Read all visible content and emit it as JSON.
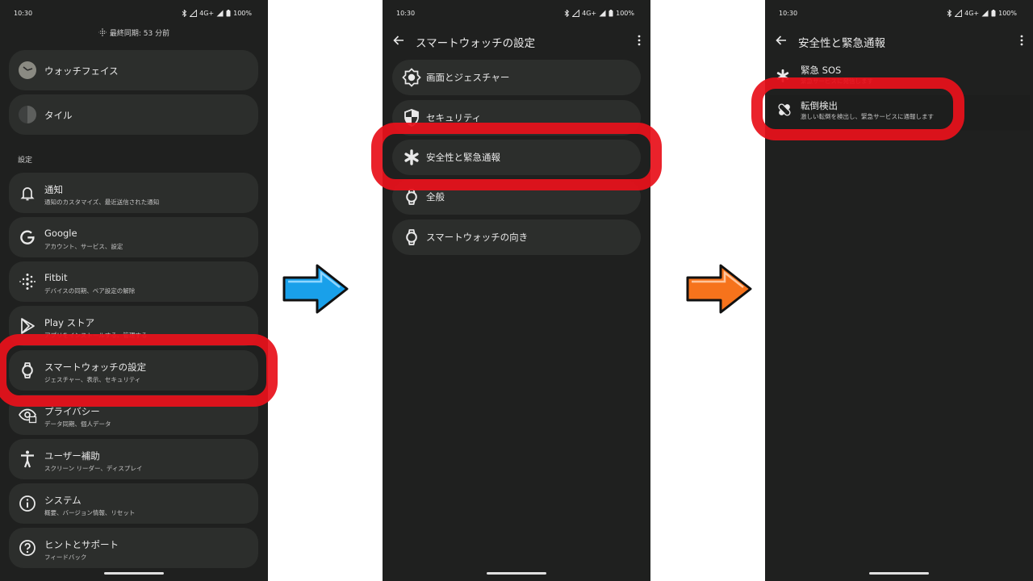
{
  "colors": {
    "background": "#1f201f",
    "card": "#2c2e2c",
    "highlight": "#e8111b",
    "arrow1": "#19a0ea",
    "arrow2": "#f6731c"
  },
  "status": {
    "time": "10:30",
    "network": "4G+",
    "battery": "100%"
  },
  "screen1": {
    "sync_text": "最終同期: 53 分前",
    "section_label": "設定",
    "items": [
      {
        "title": "ウォッチフェイス",
        "subtitle": "",
        "icon": "watchface-icon"
      },
      {
        "title": "タイル",
        "subtitle": "",
        "icon": "tile-icon"
      },
      {
        "title": "通知",
        "subtitle": "通知のカスタマイズ、最近送信された通知",
        "icon": "bell-icon"
      },
      {
        "title": "Google",
        "subtitle": "アカウント、サービス、設定",
        "icon": "google-icon"
      },
      {
        "title": "Fitbit",
        "subtitle": "デバイスの同期、ペア設定の解除",
        "icon": "fitbit-icon"
      },
      {
        "title": "Play ストア",
        "subtitle": "アプリをインストールする、管理する",
        "icon": "play-store-icon"
      },
      {
        "title": "スマートウォッチの設定",
        "subtitle": "ジェスチャー、表示、セキュリティ",
        "icon": "watch-icon"
      },
      {
        "title": "プライバシー",
        "subtitle": "データ同期、個人データ",
        "icon": "privacy-icon"
      },
      {
        "title": "ユーザー補助",
        "subtitle": "スクリーン リーダー、ディスプレイ",
        "icon": "accessibility-icon"
      },
      {
        "title": "システム",
        "subtitle": "概要、バージョン情報、リセット",
        "icon": "info-icon"
      },
      {
        "title": "ヒントとサポート",
        "subtitle": "フィードバック",
        "icon": "help-icon"
      }
    ]
  },
  "screen2": {
    "title": "スマートウォッチの設定",
    "items": [
      {
        "title": "画面とジェスチャー",
        "icon": "display-icon"
      },
      {
        "title": "セキュリティ",
        "icon": "shield-icon"
      },
      {
        "title": "安全性と緊急通報",
        "icon": "asterisk-icon"
      },
      {
        "title": "全般",
        "icon": "watch-icon"
      },
      {
        "title": "スマートウォッチの向き",
        "icon": "watch-icon"
      }
    ]
  },
  "screen3": {
    "title": "安全性と緊急通報",
    "items": [
      {
        "title": "緊急 SOS",
        "subtitle": "緊急サービスに発信します",
        "icon": "asterisk-icon"
      },
      {
        "title": "転倒検出",
        "subtitle": "激しい転倒を検出し、緊急サービスに通報します",
        "icon": "fall-detection-icon"
      }
    ]
  }
}
